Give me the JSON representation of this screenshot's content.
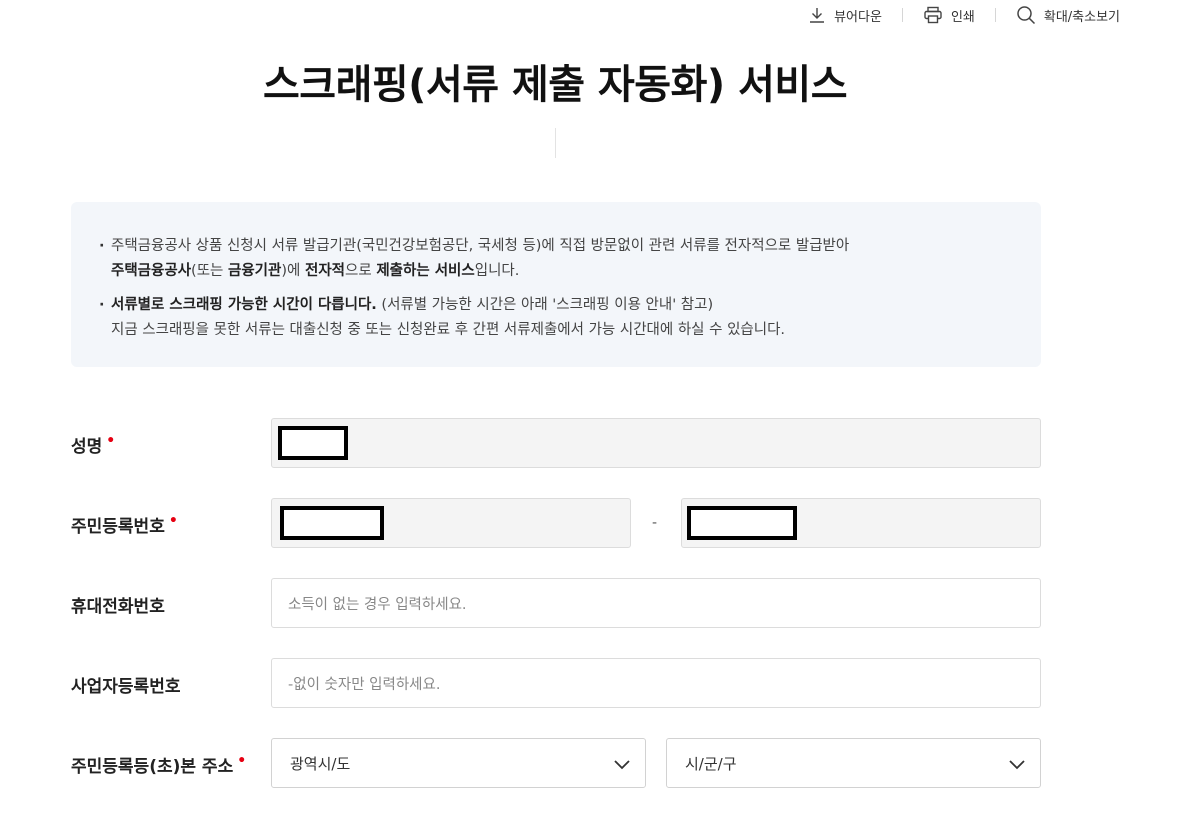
{
  "utility_bar": {
    "viewer_download": "뷰어다운",
    "print": "인쇄",
    "zoom": "확대/축소보기"
  },
  "page_title": "스크래핑(서류 제출 자동화) 서비스",
  "info": {
    "item1_line1": "주택금융공사 상품 신청시 서류 발급기관(국민건강보험공단, 국세청 등)에 직접 방문없이 관련 서류를 전자적으로 발급받아",
    "item1_line2_bold1": "주택금융공사",
    "item1_line2_text1": "(또는 ",
    "item1_line2_bold2": "금융기관",
    "item1_line2_text2": ")에 ",
    "item1_line2_bold3": "전자적",
    "item1_line2_text3": "으로 ",
    "item1_line2_bold4": "제출하는 서비스",
    "item1_line2_text4": "입니다.",
    "item2_bold": "서류별로 스크래핑 가능한 시간이 다릅니다.",
    "item2_text": " (서류별 가능한 시간은 아래 '스크래핑 이용 안내' 참고)",
    "item2_line2": "지금 스크래핑을 못한 서류는 대출신청 중 또는 신청완료 후 간편 서류제출에서 가능 시간대에 하실 수 있습니다."
  },
  "form": {
    "name_label": "성명",
    "rrn_label": "주민등록번호",
    "rrn_separator": "-",
    "phone_label": "휴대전화번호",
    "phone_placeholder": "소득이 없는 경우 입력하세요.",
    "biz_label": "사업자등록번호",
    "biz_placeholder": "-없이 숫자만 입력하세요.",
    "address_label": "주민등록등(초)본 주소",
    "address_city_value": "광역시/도",
    "address_district_value": "시/군/구",
    "required_mark": "•"
  }
}
